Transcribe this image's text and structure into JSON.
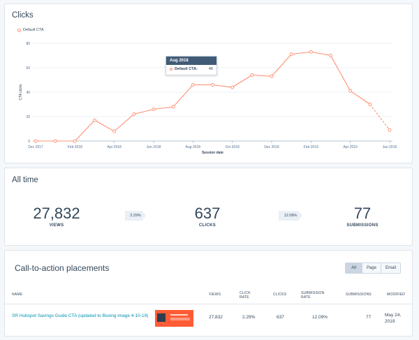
{
  "chart_card": {
    "title": "Clicks",
    "legend_label": "Default CTA",
    "tooltip": {
      "header": "Aug 2018",
      "series_label": "Default CTA:",
      "value": "46"
    }
  },
  "chart_data": {
    "type": "line",
    "title": "Clicks",
    "xlabel": "Session date",
    "ylabel": "CTA clicks",
    "ylim": [
      0,
      80
    ],
    "yticks": [
      "0",
      "20",
      "40",
      "60",
      "80"
    ],
    "xtick_labels": [
      "Dec 2017",
      "Feb 2018",
      "Apr 2018",
      "Jun 2018",
      "Aug 2018",
      "Oct 2018",
      "Dec 2018",
      "Feb 2019",
      "Apr 2019",
      "Jun 2019"
    ],
    "x": [
      "Dec 2017",
      "Jan 2018",
      "Feb 2018",
      "Mar 2018",
      "Apr 2018",
      "May 2018",
      "Jun 2018",
      "Jul 2018",
      "Aug 2018",
      "Sep 2018",
      "Oct 2018",
      "Nov 2018",
      "Dec 2018",
      "Jan 2019",
      "Feb 2019",
      "Mar 2019",
      "Apr 2019",
      "May 2019",
      "Jun 2019"
    ],
    "series": [
      {
        "name": "Default CTA",
        "color": "#ff8f73",
        "values": [
          0,
          0,
          0,
          17,
          8,
          22,
          26,
          28,
          46,
          46,
          44,
          54,
          53,
          71,
          73,
          70,
          41,
          30,
          9
        ],
        "dashed_from_index": 17
      }
    ],
    "legend_position": "top-left",
    "grid": true
  },
  "all_time": {
    "title": "All time",
    "views": {
      "value": "27,832",
      "label": "VIEWS"
    },
    "clicks": {
      "value": "637",
      "label": "CLICKS"
    },
    "submissions": {
      "value": "77",
      "label": "SUBMISSIONS"
    },
    "click_rate": "2.29%",
    "submission_rate": "12.09%"
  },
  "placements": {
    "title": "Call-to-action placements",
    "filters": [
      "All",
      "Page",
      "Email"
    ],
    "selected_filter": "All",
    "columns": [
      "NAME",
      "VIEWS",
      "CLICK RATE",
      "CLICKS",
      "SUBMISSION RATE",
      "SUBMISSIONS",
      "MODIFIED"
    ],
    "rows": [
      {
        "name": "SR Hubspot Savings Guide CTA (updated to Boxing image 4-10-19)",
        "views": "27,832",
        "click_rate": "2.29%",
        "clicks": "637",
        "submission_rate": "12.09%",
        "submissions": "77",
        "modified": "May 24, 2019"
      }
    ]
  }
}
